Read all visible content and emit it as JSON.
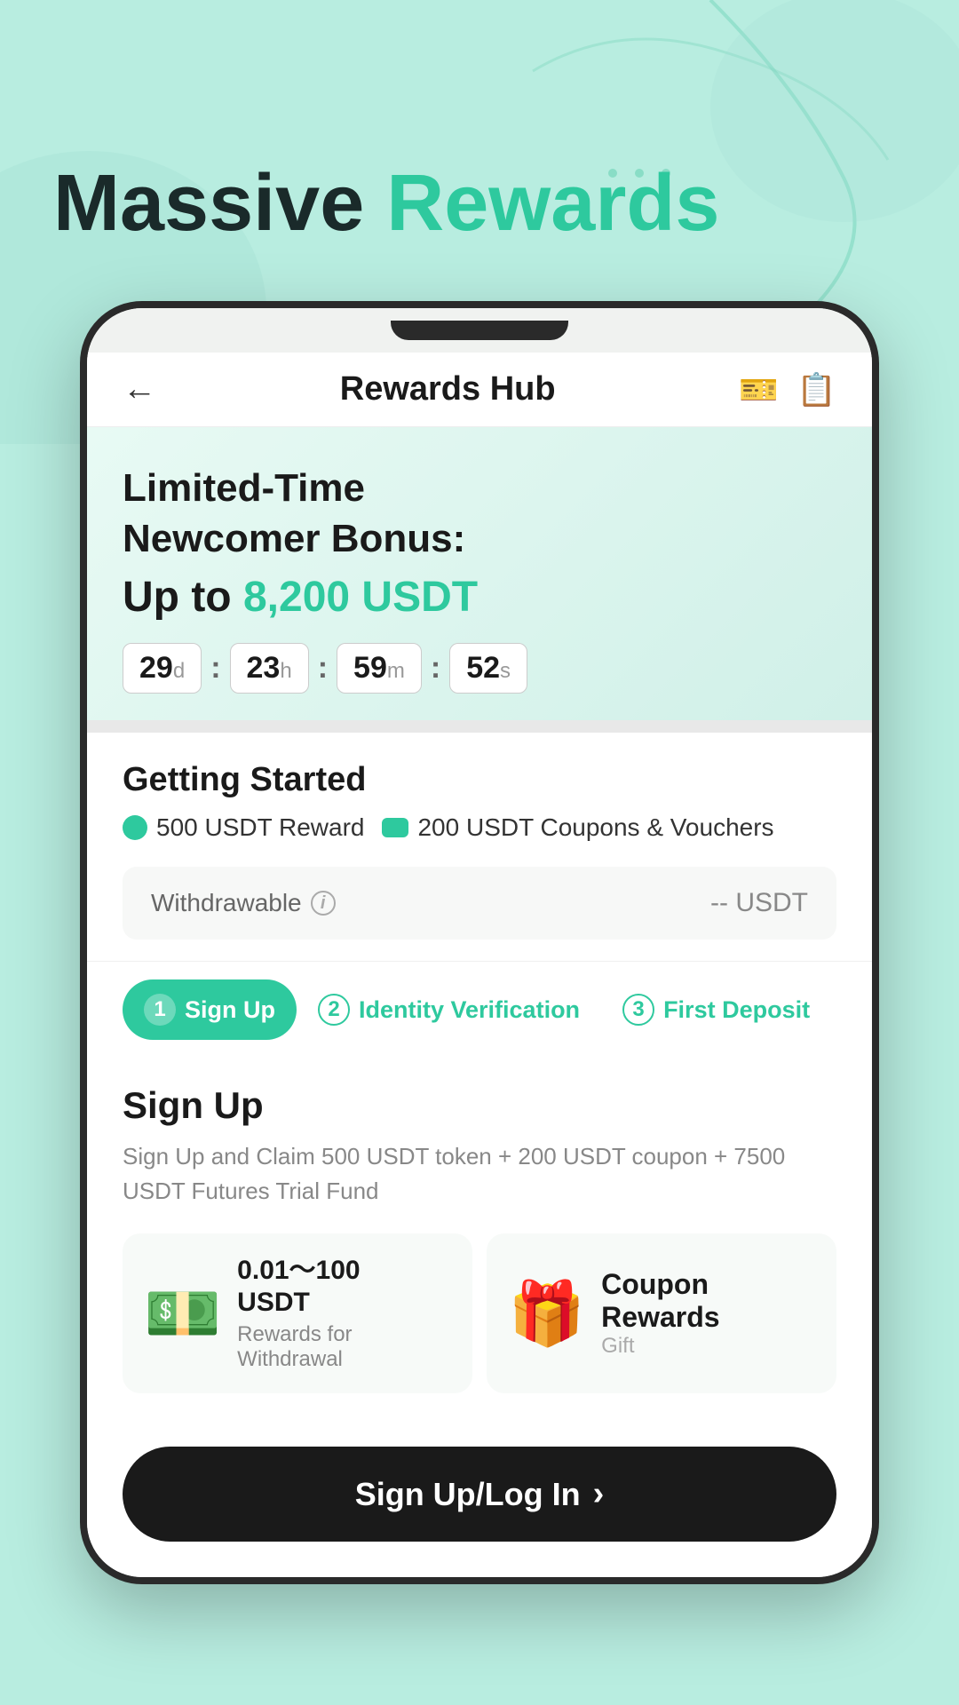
{
  "page": {
    "background_color": "#b8ede0",
    "headline": {
      "prefix": "Massive ",
      "highlight": "Rewards"
    }
  },
  "header": {
    "title": "Rewards Hub",
    "back_label": "←",
    "icon1": "🎫",
    "icon2": "📋"
  },
  "banner": {
    "title_line1": "Limited-Time",
    "title_line2": "Newcomer Bonus:",
    "amount_prefix": "Up to ",
    "amount": "8,200 USDT",
    "countdown": {
      "days": "29",
      "days_unit": "d",
      "hours": "23",
      "hours_unit": "h",
      "minutes": "59",
      "minutes_unit": "m",
      "seconds": "52",
      "seconds_unit": "s"
    }
  },
  "getting_started": {
    "title": "Getting Started",
    "badge1": "500 USDT Reward",
    "badge2": "200 USDT Coupons & Vouchers",
    "withdrawable_label": "Withdrawable",
    "withdrawable_value": "-- USDT"
  },
  "steps": [
    {
      "number": "1",
      "label": "Sign Up",
      "active": true
    },
    {
      "number": "2",
      "label": "Identity Verification",
      "active": false
    },
    {
      "number": "3",
      "label": "First Deposit",
      "active": false
    }
  ],
  "signup_card": {
    "title": "Sign Up",
    "description": "Sign Up and Claim 500 USDT token + 200 USDT coupon + 7500 USDT Futures Trial Fund",
    "reward1": {
      "emoji": "💵",
      "amount": "0.01～100",
      "amount_unit": "USDT",
      "sub": "Rewards for Withdrawal"
    },
    "reward2": {
      "emoji": "🎁",
      "name": "Coupon Rewards",
      "type": "Gift"
    }
  },
  "bottom_button": {
    "label": "Sign Up/Log In",
    "arrow": "›"
  }
}
